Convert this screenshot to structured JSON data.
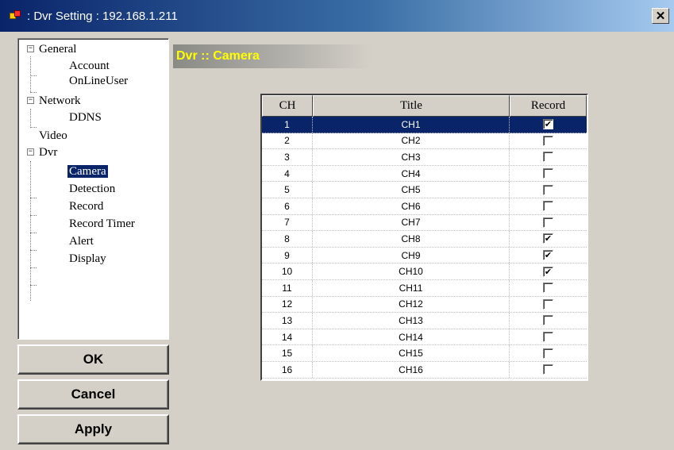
{
  "window": {
    "title": ": Dvr Setting : 192.168.1.211",
    "close_icon": "close-icon",
    "close_glyph": "✕"
  },
  "tree": {
    "items": [
      {
        "label": "General",
        "level": 0,
        "expander": "−"
      },
      {
        "label": "Account",
        "level": 1
      },
      {
        "label": "OnLineUser",
        "level": 1
      },
      {
        "label": "Network",
        "level": 0,
        "expander": "−"
      },
      {
        "label": "DDNS",
        "level": 1
      },
      {
        "label": "Video",
        "level": 0
      },
      {
        "label": "Dvr",
        "level": 0,
        "expander": "−"
      },
      {
        "label": "Camera",
        "level": 1,
        "selected": true
      },
      {
        "label": "Detection",
        "level": 1
      },
      {
        "label": "Record",
        "level": 1
      },
      {
        "label": "Record Timer",
        "level": 1
      },
      {
        "label": "Alert",
        "level": 1
      },
      {
        "label": "Display",
        "level": 1
      }
    ]
  },
  "buttons": {
    "ok": "OK",
    "cancel": "Cancel",
    "apply": "Apply"
  },
  "section": {
    "header": "Dvr :: Camera"
  },
  "grid": {
    "columns": [
      "CH",
      "Title",
      "Record"
    ],
    "rows": [
      {
        "ch": "1",
        "title": "CH1",
        "record": true,
        "selected": true
      },
      {
        "ch": "2",
        "title": "CH2",
        "record": false
      },
      {
        "ch": "3",
        "title": "CH3",
        "record": false
      },
      {
        "ch": "4",
        "title": "CH4",
        "record": false
      },
      {
        "ch": "5",
        "title": "CH5",
        "record": false
      },
      {
        "ch": "6",
        "title": "CH6",
        "record": false
      },
      {
        "ch": "7",
        "title": "CH7",
        "record": false
      },
      {
        "ch": "8",
        "title": "CH8",
        "record": true
      },
      {
        "ch": "9",
        "title": "CH9",
        "record": true
      },
      {
        "ch": "10",
        "title": "CH10",
        "record": true
      },
      {
        "ch": "11",
        "title": "CH11",
        "record": false
      },
      {
        "ch": "12",
        "title": "CH12",
        "record": false
      },
      {
        "ch": "13",
        "title": "CH13",
        "record": false
      },
      {
        "ch": "14",
        "title": "CH14",
        "record": false
      },
      {
        "ch": "15",
        "title": "CH15",
        "record": false
      },
      {
        "ch": "16",
        "title": "CH16",
        "record": false
      }
    ]
  },
  "colors": {
    "titlebar_start": "#0a246a",
    "selection": "#0a246a",
    "header_text": "#ffff00",
    "face": "#d4d0c8"
  }
}
